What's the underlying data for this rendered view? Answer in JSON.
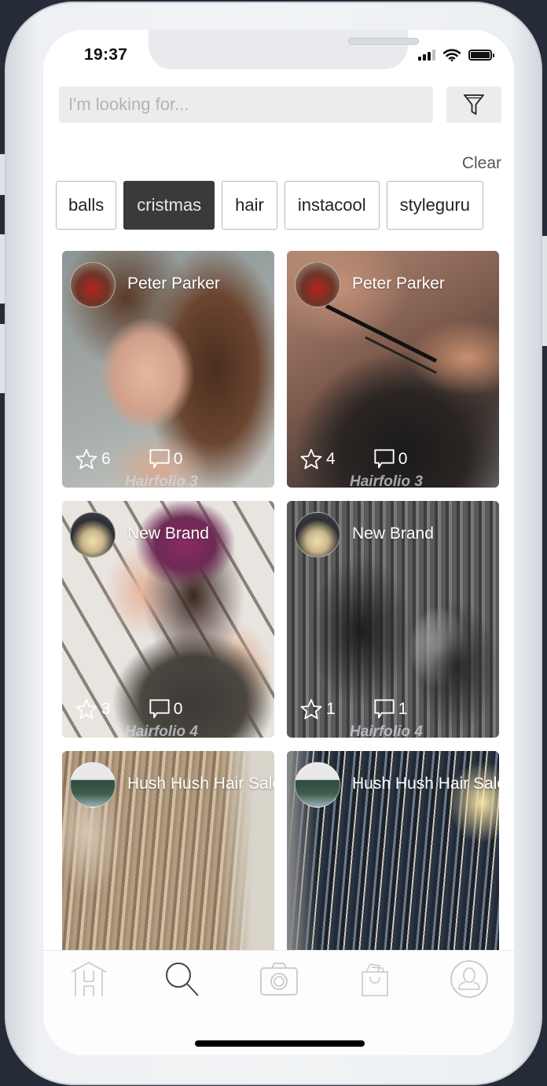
{
  "status_bar": {
    "time": "19:37"
  },
  "search": {
    "placeholder": "I'm looking for...",
    "value": "",
    "filter_icon": "funnel-icon"
  },
  "tags": {
    "clear_label": "Clear",
    "items": [
      {
        "label": "balls",
        "active": false
      },
      {
        "label": "cristmas",
        "active": true
      },
      {
        "label": "hair",
        "active": false
      },
      {
        "label": "instacool",
        "active": false
      },
      {
        "label": "styleguru",
        "active": false
      }
    ]
  },
  "posts": [
    {
      "author": "Peter Parker",
      "stars": "6",
      "comments": "0",
      "watermark": "Hairfolio 3"
    },
    {
      "author": "Peter Parker",
      "stars": "4",
      "comments": "0",
      "watermark": "Hairfolio 3"
    },
    {
      "author": "New Brand",
      "stars": "3",
      "comments": "0",
      "watermark": "Hairfolio 4"
    },
    {
      "author": "New Brand",
      "stars": "1",
      "comments": "1",
      "watermark": "Hairfolio 4"
    },
    {
      "author": "Hush Hush Hair Salon",
      "stars": "",
      "comments": "",
      "watermark": ""
    },
    {
      "author": "Hush Hush Hair Salon",
      "stars": "",
      "comments": "",
      "watermark": ""
    }
  ],
  "tabbar": {
    "items": [
      {
        "name": "home",
        "icon": "home-icon",
        "active": false
      },
      {
        "name": "search",
        "icon": "search-icon",
        "active": true
      },
      {
        "name": "camera",
        "icon": "camera-icon",
        "active": false
      },
      {
        "name": "shop",
        "icon": "shopping-bag-icon",
        "active": false
      },
      {
        "name": "profile",
        "icon": "profile-icon",
        "active": false
      }
    ]
  },
  "colors": {
    "active_chip": "#3a3a3a",
    "search_bg": "#ececec",
    "tab_inactive": "#c8c8c8",
    "tab_active": "#444444"
  }
}
